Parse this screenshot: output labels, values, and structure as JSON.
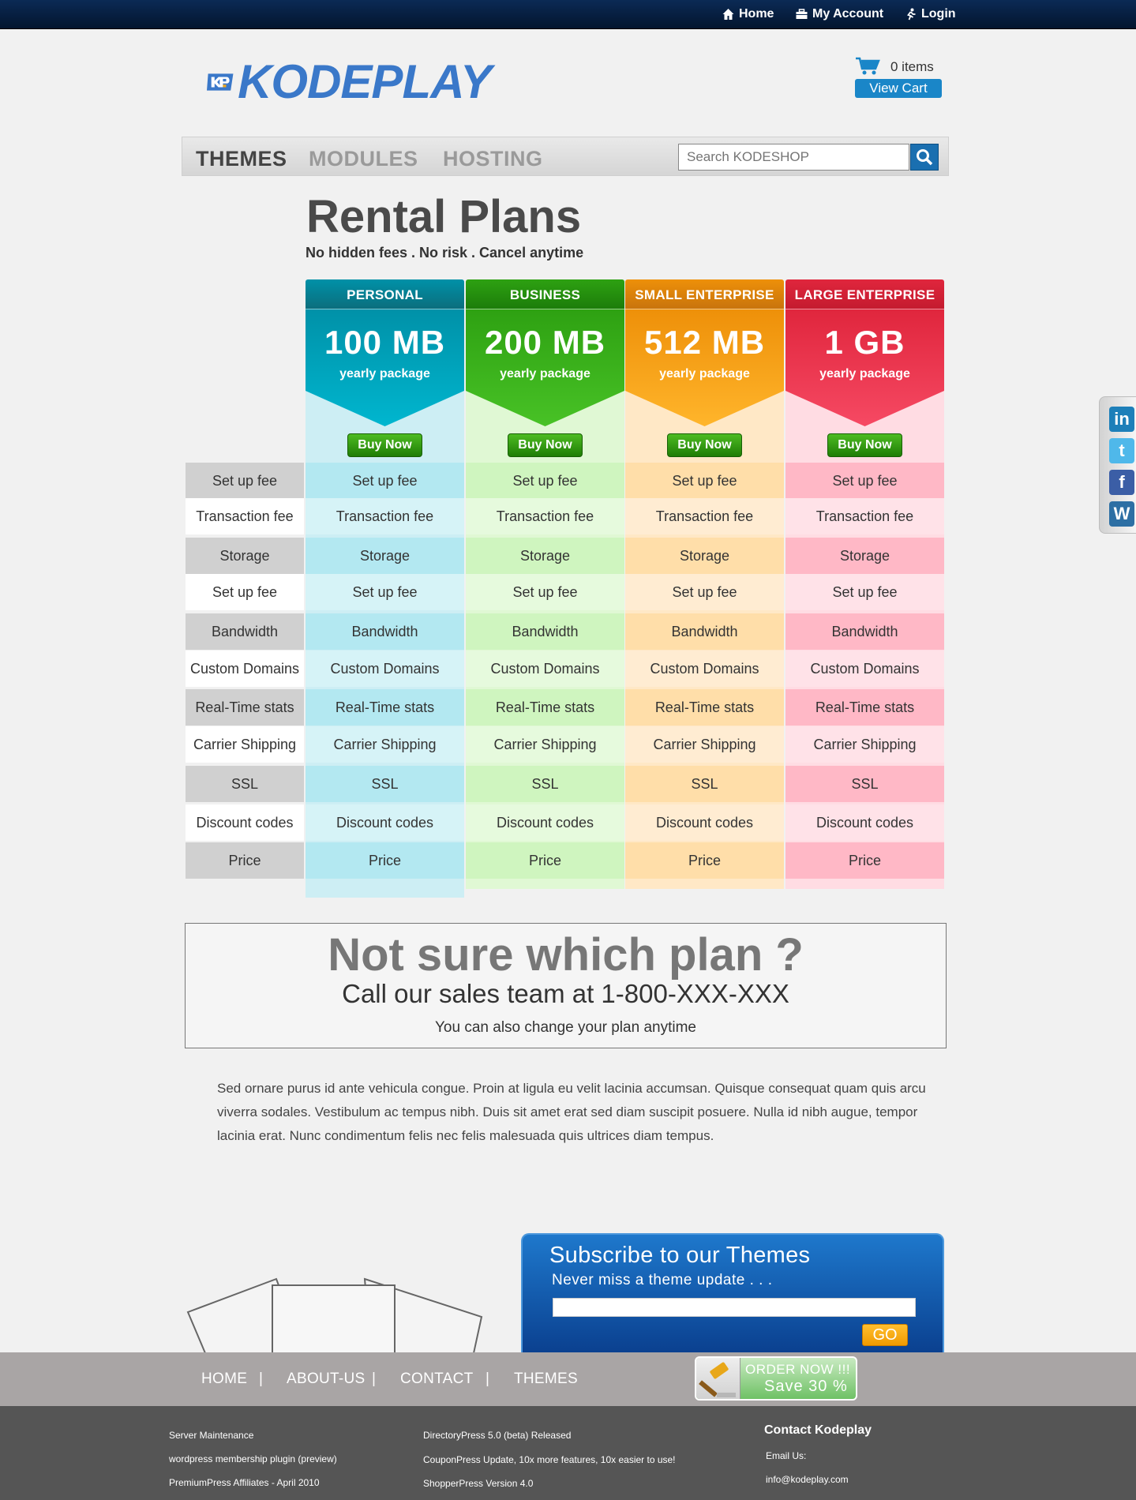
{
  "topnav": {
    "home": "Home",
    "account": "My Account",
    "login": "Login"
  },
  "brand": {
    "name": "KODEPLAY",
    "color": "#3a78c9"
  },
  "cart": {
    "count": "0 items",
    "view": "View Cart"
  },
  "mainnav": {
    "themes": "THEMES",
    "modules": "MODULES",
    "hosting": "HOSTING"
  },
  "search": {
    "placeholder": "Search KODESHOP"
  },
  "heading": {
    "title": "Rental Plans",
    "subtitle": "No hidden fees . No risk . Cancel anytime"
  },
  "plans": [
    {
      "name": "PERSONAL",
      "size": "100 MB",
      "period": "yearly package",
      "buy": "Buy Now",
      "color": "#00a9c6"
    },
    {
      "name": "BUSINESS",
      "size": "200 MB",
      "period": "yearly package",
      "buy": "Buy Now",
      "color": "#37b51a"
    },
    {
      "name": "SMALL ENTERPRISE",
      "size": "512 MB",
      "period": "yearly package",
      "buy": "Buy Now",
      "color": "#f79d12"
    },
    {
      "name": "LARGE ENTERPRISE",
      "size": "1 GB",
      "period": "yearly package",
      "buy": "Buy Now",
      "color": "#e8263c"
    }
  ],
  "features": [
    "Set up fee",
    "Transaction fee",
    "Storage",
    "Set up fee",
    "Bandwidth",
    "Custom Domains",
    "Real-Time stats",
    "Carrier Shipping",
    "SSL",
    "Discount codes",
    "Price"
  ],
  "help": {
    "title": "Not sure which plan ?",
    "call": "Call our sales team at 1-800-XXX-XXX",
    "note": "You can also change your plan anytime"
  },
  "body_text": "Sed ornare purus id ante vehicula congue. Proin at ligula eu velit lacinia accumsan. Quisque consequat quam quis arcu viverra sodales. Vestibulum ac tempus nibh. Duis sit amet erat sed diam suscipit posuere. Nulla id nibh augue, tempor lacinia erat. Nunc condimentum felis nec felis malesuada quis ultrices diam tempus.",
  "subscribe": {
    "title": "Subscribe to our Themes",
    "subtitle": "Never miss a theme update . . .",
    "go": "GO"
  },
  "footnav": {
    "home": "HOME",
    "about": "ABOUT-US",
    "contact": "CONTACT",
    "themes": "THEMES",
    "sep": "|"
  },
  "order": {
    "line1": "ORDER NOW !!!",
    "line2": "Save 30 %"
  },
  "footer": {
    "col1": [
      "Server Maintenance",
      "wordpress membership plugin (preview)",
      "PremiumPress Affiliates - April 2010"
    ],
    "col2": [
      "DirectoryPress 5.0 (beta) Released",
      "CouponPress Update, 10x more features, 10x easier to use!",
      "ShopperPress Version 4.0"
    ],
    "contact": {
      "heading": "Contact Kodeplay",
      "email_label": "Email Us:",
      "email": "info@kodeplay.com"
    }
  },
  "social": [
    "linkedin-icon",
    "twitter-icon",
    "facebook-icon",
    "wordpress-icon"
  ]
}
